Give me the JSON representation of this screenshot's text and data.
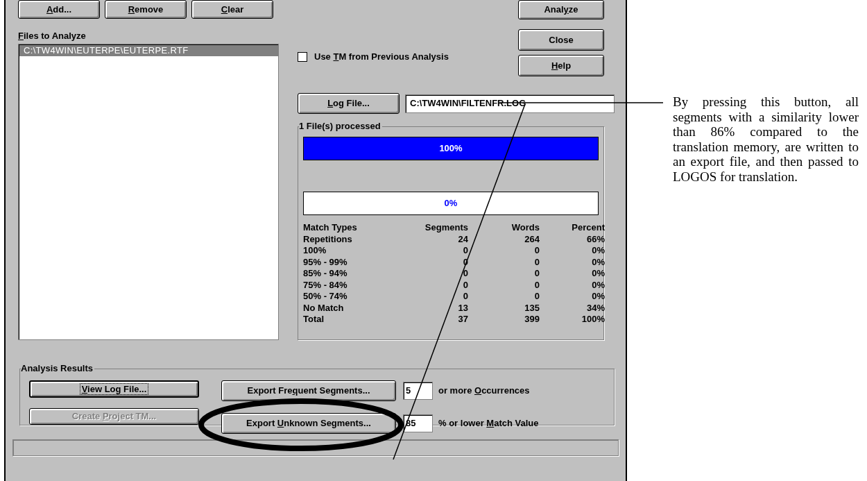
{
  "file_buttons": [
    {
      "key": "A",
      "post": "dd..."
    },
    {
      "key": "R",
      "post": "emove"
    },
    {
      "key": "C",
      "post": "lear"
    }
  ],
  "files_label": {
    "key": "F",
    "post": "iles to Analyze"
  },
  "files": [
    {
      "path": "C:\\TW4WIN\\EUTERPE\\EUTERPE.RTF",
      "selected": true
    }
  ],
  "action_buttons": [
    {
      "pre": "Anal",
      "key": "y",
      "post": "ze"
    },
    {
      "pre": "Close"
    },
    {
      "key": "H",
      "post": "elp"
    }
  ],
  "use_previous_tm": {
    "label": {
      "pre": "Use ",
      "key": "T",
      "post": "M from Previous Analysis"
    },
    "checked": false
  },
  "log_file": {
    "button": {
      "key": "L",
      "post": "og File..."
    },
    "value": "C:\\TW4WIN\\FILTENFR.LOG"
  },
  "progress": {
    "title": "1 File(s) processed",
    "bars": [
      {
        "reading": "100%",
        "level": 1
      },
      {
        "reading": "0%",
        "level": 0
      }
    ]
  },
  "table": {
    "columns": [
      "Match Types",
      "Segments",
      "Words",
      "Percent"
    ],
    "rows": [
      [
        "Repetitions",
        "24",
        "264",
        "66%"
      ],
      [
        "100%",
        "0",
        "0",
        "0%"
      ],
      [
        "95% - 99%",
        "0",
        "0",
        "0%"
      ],
      [
        "85% - 94%",
        "0",
        "0",
        "0%"
      ],
      [
        "75% - 84%",
        "0",
        "0",
        "0%"
      ],
      [
        "50% - 74%",
        "0",
        "0",
        "0%"
      ],
      [
        "No Match",
        "13",
        "135",
        "34%"
      ],
      [
        "Total",
        "37",
        "399",
        "100%"
      ]
    ]
  },
  "analysis_results": {
    "title": "Analysis Results",
    "buttons": [
      {
        "label": {
          "key": "V",
          "post": "iew Log File..."
        },
        "disabled": false,
        "default": true
      },
      {
        "label": {
          "pre": "Create ",
          "key": "P",
          "post": "roject TM..."
        },
        "disabled": true,
        "default": false
      }
    ],
    "exports": [
      {
        "button": {
          "pre": "Export Fre",
          "key": "q",
          "post": "uent Segments..."
        },
        "value": "5",
        "suffix": {
          "pre": "or more ",
          "key": "O",
          "post": "ccurrences"
        }
      },
      {
        "button": {
          "pre": "Export ",
          "key": "U",
          "post": "nknown Segments..."
        },
        "value": "85",
        "suffix": {
          "pre": "% or lower ",
          "key": "M",
          "post": "atch Value"
        }
      }
    ]
  },
  "annotation": "By pressing this button, all segments with a similarity lower than 86% compared to the translation memory, are written to an export file, and then passed to LOGOS for translation."
}
